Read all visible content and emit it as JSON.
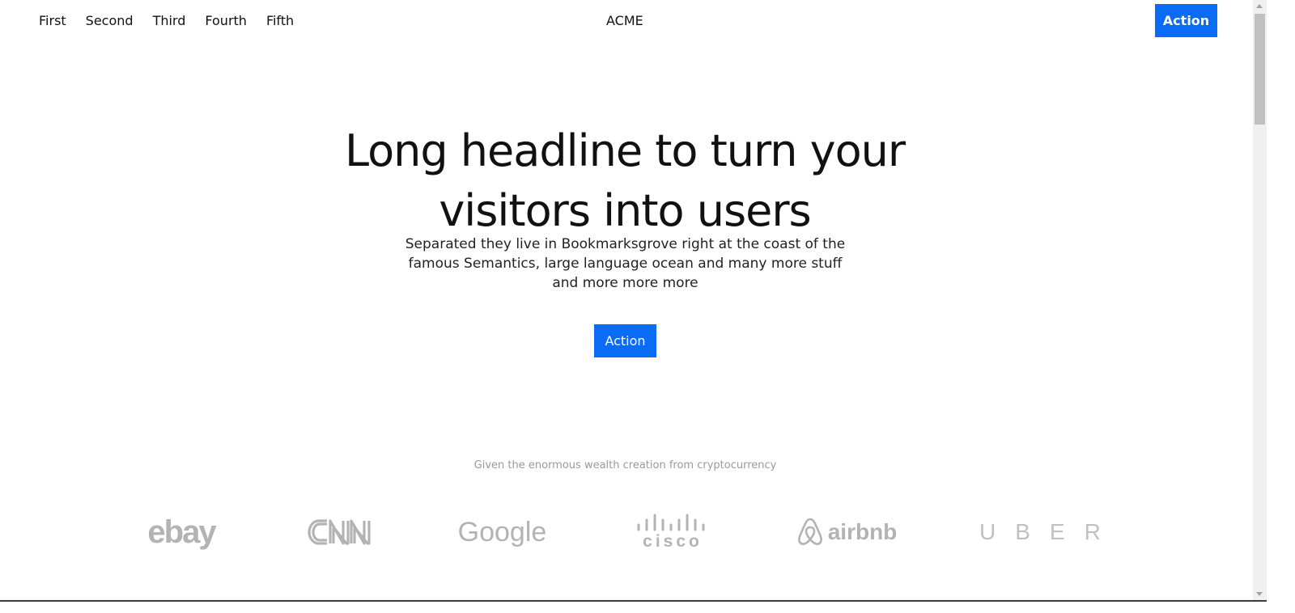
{
  "nav": {
    "links": [
      "First",
      "Second",
      "Third",
      "Fourth",
      "Fifth"
    ],
    "brand": "ACME",
    "action_label": "Action"
  },
  "hero": {
    "title_line1": "Long headline to turn your",
    "title_line2": "visitors into users",
    "subtitle": "Separated they live in Bookmarksgrove right at the coast of the famous Semantics, large language ocean and many more stuff and more more more",
    "action_label": "Action"
  },
  "logos": {
    "tagline": "Given the enormous wealth creation from cryptocurrency",
    "items": [
      "ebay",
      "CNN",
      "Google",
      "cisco",
      "airbnb",
      "UBER"
    ]
  },
  "colors": {
    "accent": "#0a6cf5",
    "logo_gray": "#b3b3b3",
    "tagline_gray": "#9a9a9a"
  }
}
